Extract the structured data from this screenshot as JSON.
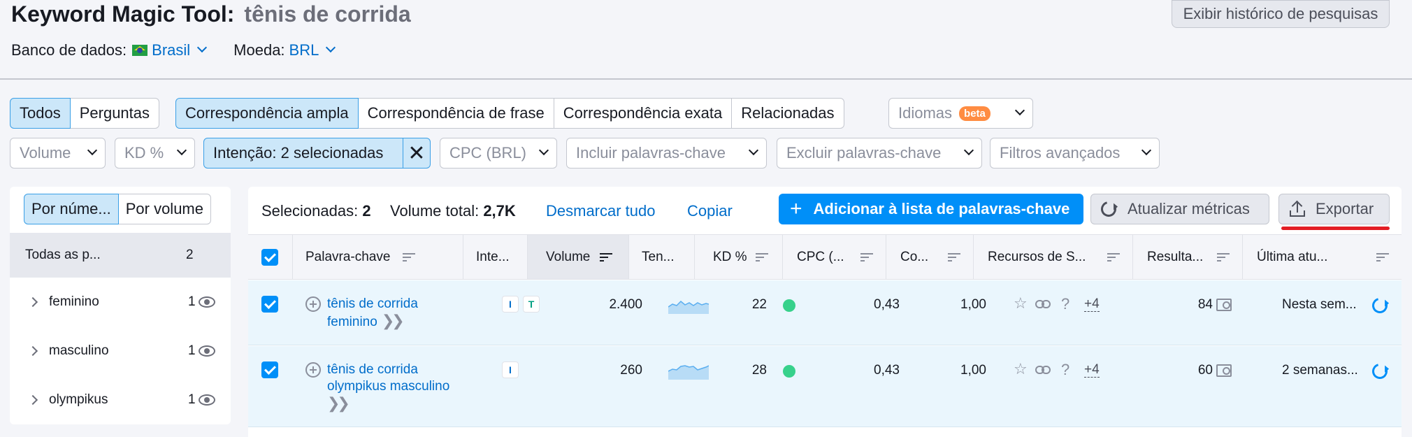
{
  "header": {
    "title": "Keyword Magic Tool:",
    "query": "tênis de corrida",
    "history_button": "Exibir histórico de pesquisas",
    "database_label": "Banco de dados:",
    "database_value": "Brasil",
    "currency_label": "Moeda:",
    "currency_value": "BRL"
  },
  "match_tabs": {
    "all": "Todos",
    "questions": "Perguntas",
    "broad": "Correspondência ampla",
    "phrase": "Correspondência de frase",
    "exact": "Correspondência exata",
    "related": "Relacionadas"
  },
  "languages": {
    "label": "Idiomas",
    "badge": "beta"
  },
  "filters": {
    "volume": "Volume",
    "kd": "KD %",
    "intent": "Intenção: 2 selecionadas",
    "cpc": "CPC (BRL)",
    "include": "Incluir palavras-chave",
    "exclude": "Excluir palavras-chave",
    "advanced": "Filtros avançados"
  },
  "left_panel": {
    "by_number": "Por núme...",
    "by_volume": "Por volume",
    "all_label": "Todas as p...",
    "all_count": "2",
    "groups": [
      {
        "name": "feminino",
        "count": "1"
      },
      {
        "name": "masculino",
        "count": "1"
      },
      {
        "name": "olympikus",
        "count": "1"
      }
    ]
  },
  "toolbar": {
    "selected_label": "Selecionadas:",
    "selected_count": "2",
    "total_volume_label": "Volume total:",
    "total_volume": "2,7K",
    "unmark_all": "Desmarcar tudo",
    "copy": "Copiar",
    "add_to_list": "Adicionar à lista de palavras-chave",
    "update_metrics": "Atualizar métricas",
    "export": "Exportar"
  },
  "table": {
    "columns": [
      "Palavra-chave",
      "Inte...",
      "Volume",
      "Ten...",
      "KD %",
      "CPC (...",
      "Co...",
      "Recursos de S...",
      "Resulta...",
      "Última atu..."
    ],
    "rows": [
      {
        "keyword_line1": "tênis de corrida",
        "keyword_line2": "feminino",
        "intents": [
          "I",
          "T"
        ],
        "volume": "2.400",
        "kd": "22",
        "cpc": "0,43",
        "competition": "1,00",
        "serp_more": "+4",
        "results": "84",
        "updated": "Nesta sem..."
      },
      {
        "keyword_line1": "tênis de corrida",
        "keyword_line2": "olympikus masculino",
        "intents": [
          "I"
        ],
        "volume": "260",
        "kd": "28",
        "cpc": "0,43",
        "competition": "1,00",
        "serp_more": "+4",
        "results": "60",
        "updated": "2 semanas..."
      }
    ]
  },
  "colors": {
    "accent": "#008ff8",
    "link": "#006dca",
    "active_bg": "#cce7f9",
    "kd_easy": "#37d18b",
    "highlight": "#e31e24"
  }
}
